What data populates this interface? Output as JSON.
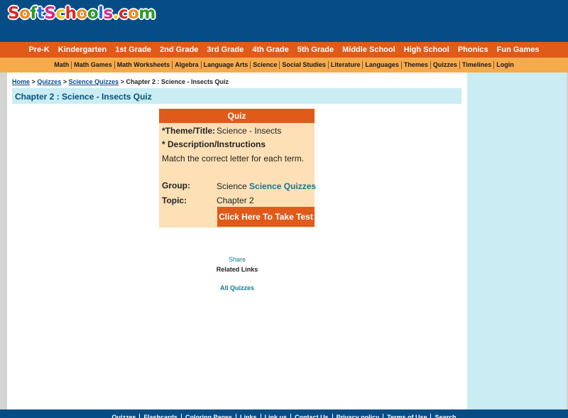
{
  "site": {
    "logo_text": "SoftSchools.com"
  },
  "nav_primary": [
    "Pre-K",
    "Kindergarten",
    "1st Grade",
    "2nd Grade",
    "3rd Grade",
    "4th Grade",
    "5th Grade",
    "Middle School",
    "High School",
    "Phonics",
    "Fun Games"
  ],
  "nav_secondary": [
    "Math",
    "Math Games",
    "Math Worksheets",
    "Algebra",
    "Language Arts",
    "Science",
    "Social Studies",
    "Literature",
    "Languages",
    "Themes",
    "Quizzes",
    "Timelines",
    "Login"
  ],
  "breadcrumb": {
    "home": "Home",
    "sep": ">",
    "quizzes": "Quizzes",
    "science_quizzes": "Science Quizzes",
    "current": "Chapter 2 : Science - Insects Quiz"
  },
  "page_title": "Chapter 2 : Science - Insects Quiz",
  "quiz": {
    "header": "Quiz",
    "theme_label": "*Theme/Title:",
    "theme_value": "Science - Insects",
    "desc_label": "* Description/Instructions",
    "desc_value": "Match the correct letter for each term.",
    "group_label": "Group:",
    "group_value": "Science",
    "group_link": "Science Quizzes",
    "topic_label": "Topic:",
    "topic_value": "Chapter 2",
    "take_test": "Click Here To Take Test"
  },
  "share": {
    "share": "Share",
    "related": "Related Links",
    "all_quizzes": "All Quizzes"
  },
  "footer": [
    "Quizzes",
    "Flashcards",
    "Coloring Pages",
    "Links",
    "Link us",
    "Contact Us",
    "Privacy policy",
    "Terms of Use",
    "Search"
  ],
  "colors": {
    "header_bg": "#064d86",
    "nav1_bg": "#e05a1a",
    "nav2_bg": "#f6aa4e",
    "title_bg": "#c9edf3",
    "quiz_bg": "#fde0b5"
  }
}
